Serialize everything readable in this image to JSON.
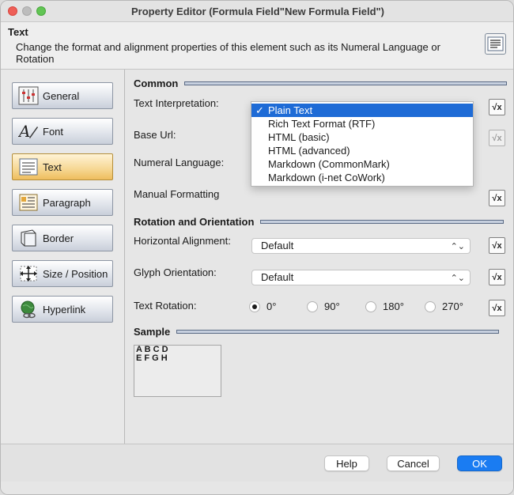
{
  "window": {
    "title": "Property Editor (Formula Field\"New Formula Field\")"
  },
  "header": {
    "title": "Text",
    "description": "Change the format and alignment properties of this element such as its Numeral Language or Rotation"
  },
  "sidebar": {
    "items": [
      {
        "label": "General",
        "icon": "sliders-icon",
        "active": false
      },
      {
        "label": "Font",
        "icon": "font-icon",
        "active": false
      },
      {
        "label": "Text",
        "icon": "text-lines-icon",
        "active": true
      },
      {
        "label": "Paragraph",
        "icon": "paragraph-icon",
        "active": false
      },
      {
        "label": "Border",
        "icon": "border-icon",
        "active": false
      },
      {
        "label": "Size / Position",
        "icon": "move-icon",
        "active": false
      },
      {
        "label": "Hyperlink",
        "icon": "globe-link-icon",
        "active": false
      }
    ]
  },
  "common": {
    "heading": "Common",
    "text_interpretation_label": "Text Interpretation:",
    "base_url_label": "Base Url:",
    "numeral_language_label": "Numeral Language:",
    "manual_formatting_label": "Manual Formatting"
  },
  "dropdown": {
    "options": [
      "Plain Text",
      "Rich Text Format (RTF)",
      "HTML (basic)",
      "HTML (advanced)",
      "Markdown (CommonMark)",
      "Markdown (i-net CoWork)"
    ],
    "selected": "Plain Text",
    "checkmark": "✓"
  },
  "rotation": {
    "heading": "Rotation and Orientation",
    "horizontal_alignment_label": "Horizontal Alignment:",
    "horizontal_alignment_value": "Default",
    "glyph_orientation_label": "Glyph Orientation:",
    "glyph_orientation_value": "Default",
    "text_rotation_label": "Text Rotation:",
    "rotation_options": [
      "0°",
      "90°",
      "180°",
      "270°"
    ],
    "rotation_selected": "0°"
  },
  "sample": {
    "heading": "Sample",
    "line1": "A B C D",
    "line2": "E F G H"
  },
  "formula_button": {
    "label": "√x"
  },
  "select_arrows": "⌃⌄",
  "footer": {
    "help": "Help",
    "cancel": "Cancel",
    "ok": "OK"
  },
  "colors": {
    "accent": "#1a7cf2",
    "active_nav": "#f6d792",
    "selection": "#1e6bd6"
  }
}
